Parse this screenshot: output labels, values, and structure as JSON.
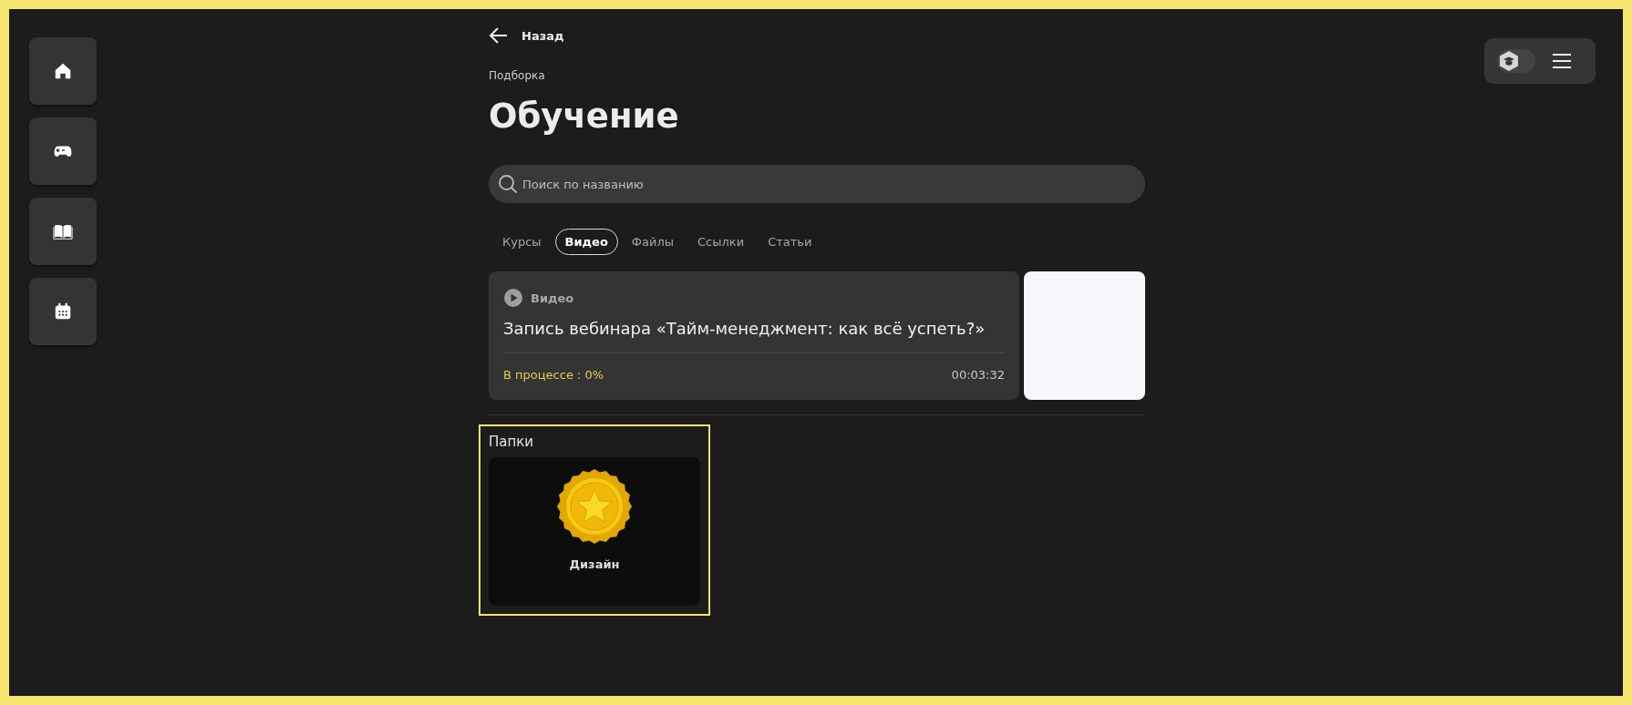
{
  "back_link": "Назад",
  "eyebrow": "Подборка",
  "title": "Обучение",
  "search": {
    "placeholder": "Поиск по названию"
  },
  "tabs": [
    {
      "label": "Курсы",
      "selected": false
    },
    {
      "label": "Видео",
      "selected": true
    },
    {
      "label": "Файлы",
      "selected": false
    },
    {
      "label": "Ссылки",
      "selected": false
    },
    {
      "label": "Статьи",
      "selected": false
    }
  ],
  "items": [
    {
      "type": "Видео",
      "title": "Запись вебинара «Тайм-менеджмент: как всё успеть?»",
      "status": "В процессе : 0%",
      "duration": "00:03:32"
    }
  ],
  "folders": {
    "title": "Папки",
    "items": [
      {
        "name": "Дизайн"
      }
    ]
  },
  "mode_switch": {
    "on": false
  }
}
